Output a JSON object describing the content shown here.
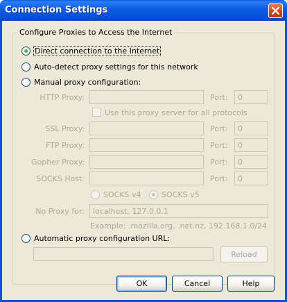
{
  "window": {
    "title": "Connection Settings",
    "close_glyph": "close-icon"
  },
  "group": {
    "legend": "Configure Proxies to Access the Internet"
  },
  "options": {
    "direct": {
      "label": "Direct connection to the Internet",
      "checked": true
    },
    "autodetect": {
      "label": "Auto-detect proxy settings for this network",
      "checked": false
    },
    "manual": {
      "label": "Manual proxy configuration:",
      "checked": false
    },
    "auto_url": {
      "label": "Automatic proxy configuration URL:",
      "checked": false
    }
  },
  "manual": {
    "http_label": "HTTP Proxy:",
    "http_value": "",
    "http_port_label": "Port:",
    "http_port_value": "0",
    "use_same_label": "Use this proxy server for all protocols",
    "ssl_label": "SSL Proxy:",
    "ssl_value": "",
    "ssl_port_label": "Port:",
    "ssl_port_value": "0",
    "ftp_label": "FTP Proxy:",
    "ftp_value": "",
    "ftp_port_label": "Port:",
    "ftp_port_value": "0",
    "gopher_label": "Gopher Proxy:",
    "gopher_value": "",
    "gopher_port_label": "Port:",
    "gopher_port_value": "0",
    "socks_label": "SOCKS Host:",
    "socks_value": "",
    "socks_port_label": "Port:",
    "socks_port_value": "0",
    "socks_v4_label": "SOCKS v4",
    "socks_v5_label": "SOCKS v5",
    "socks_version_selected": "SOCKS v5",
    "no_proxy_label": "No Proxy for:",
    "no_proxy_value": "localhost, 127.0.0.1",
    "example_text": "Example: .mozilla.org, .net.nz, 192.168.1.0/24"
  },
  "auto_config": {
    "url_value": "",
    "reload_label": "Reload"
  },
  "buttons": {
    "ok": "OK",
    "cancel": "Cancel",
    "help": "Help"
  },
  "colors": {
    "titlebar": "#0b5ce4",
    "dialog_bg": "#ece9d8",
    "disabled_text": "#aca899",
    "radio_check": "#1d9a1d"
  }
}
